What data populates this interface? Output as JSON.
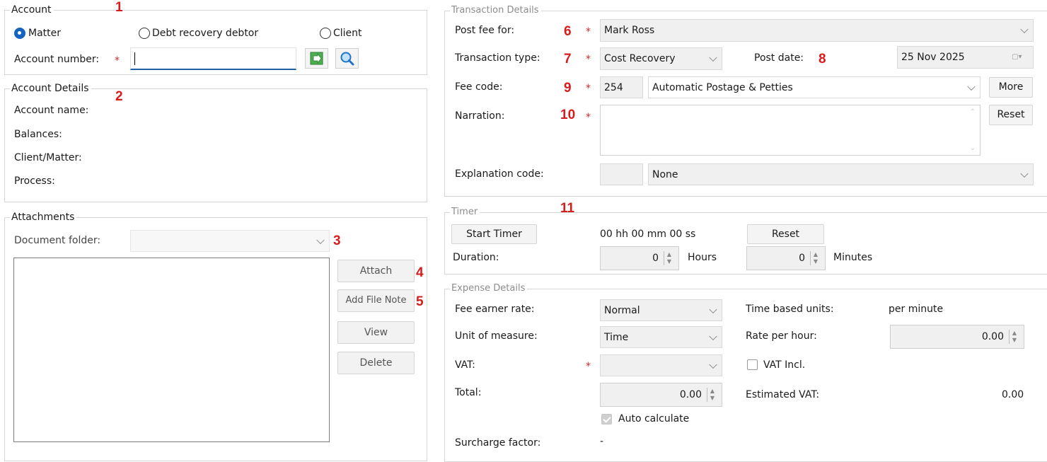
{
  "account": {
    "legend": "Account",
    "radio_matter": "Matter",
    "radio_debt": "Debt recovery debtor",
    "radio_client": "Client",
    "account_number_label": "Account number:",
    "required_mark": "*",
    "account_number_value": ""
  },
  "account_details": {
    "legend": "Account Details",
    "account_name": "Account name:",
    "balances": "Balances:",
    "client_matter": "Client/Matter:",
    "process": "Process:"
  },
  "attachments": {
    "legend": "Attachments",
    "document_folder_label": "Document folder:",
    "document_folder_value": "",
    "attach": "Attach",
    "add_file_note": "Add File Note",
    "view": "View",
    "delete": "Delete"
  },
  "transaction": {
    "legend": "Transaction Details",
    "post_fee_for_label": "Post fee for:",
    "post_fee_for_value": "Mark Ross",
    "transaction_type_label": "Transaction type:",
    "transaction_type_value": "Cost Recovery",
    "post_date_label": "Post date:",
    "post_date_value": "25 Nov  2025",
    "fee_code_label": "Fee code:",
    "fee_code_value": "254",
    "fee_code_desc": "Automatic Postage & Petties",
    "more": "More",
    "narration_label": "Narration:",
    "narration_value": "",
    "reset": "Reset",
    "explanation_code_label": "Explanation code:",
    "explanation_code_value": "",
    "explanation_desc": "None"
  },
  "timer": {
    "legend": "Timer",
    "start_timer": "Start Timer",
    "elapsed": "00 hh 00 mm 00 ss",
    "reset": "Reset",
    "duration_label": "Duration:",
    "hours_value": "0",
    "hours_label": "Hours",
    "minutes_value": "0",
    "minutes_label": "Minutes"
  },
  "expense": {
    "legend": "Expense Details",
    "fee_earner_rate_label": "Fee earner rate:",
    "fee_earner_rate_value": "Normal",
    "time_based_units_label": "Time based units:",
    "time_based_units_value": "per minute",
    "unit_of_measure_label": "Unit of measure:",
    "unit_of_measure_value": "Time",
    "rate_per_hour_label": "Rate per hour:",
    "rate_per_hour_value": "0.00",
    "vat_label": "VAT:",
    "vat_value": "",
    "vat_incl_label": "VAT Incl.",
    "total_label": "Total:",
    "total_value": "0.00",
    "estimated_vat_label": "Estimated VAT:",
    "estimated_vat_value": "0.00",
    "auto_calculate_label": "Auto calculate",
    "surcharge_factor_label": "Surcharge factor:",
    "surcharge_factor_value": "-"
  },
  "annotations": [
    "1",
    "2",
    "3",
    "4",
    "5",
    "6",
    "7",
    "8",
    "9",
    "10",
    "11"
  ],
  "colors": {
    "annotation": "#d81b1b",
    "accent": "#1565c0",
    "field_bg": "#f0f0f0"
  }
}
